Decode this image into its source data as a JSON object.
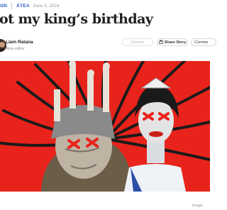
{
  "header": {
    "section_label": "ON",
    "publisher": "ÁTEA",
    "date": "June 3, 2024"
  },
  "article": {
    "headline": "ot my king’s birthday"
  },
  "byline": {
    "author_name": "Liam Ratana",
    "author_role": "Átea editor"
  },
  "actions": {
    "opinion_label": "Opinion",
    "share_label": "Share Story",
    "comment_label": "Comme"
  },
  "hero": {
    "caption": "Image",
    "background_color": "#e8231b",
    "accent_color": "#2a59c8"
  }
}
